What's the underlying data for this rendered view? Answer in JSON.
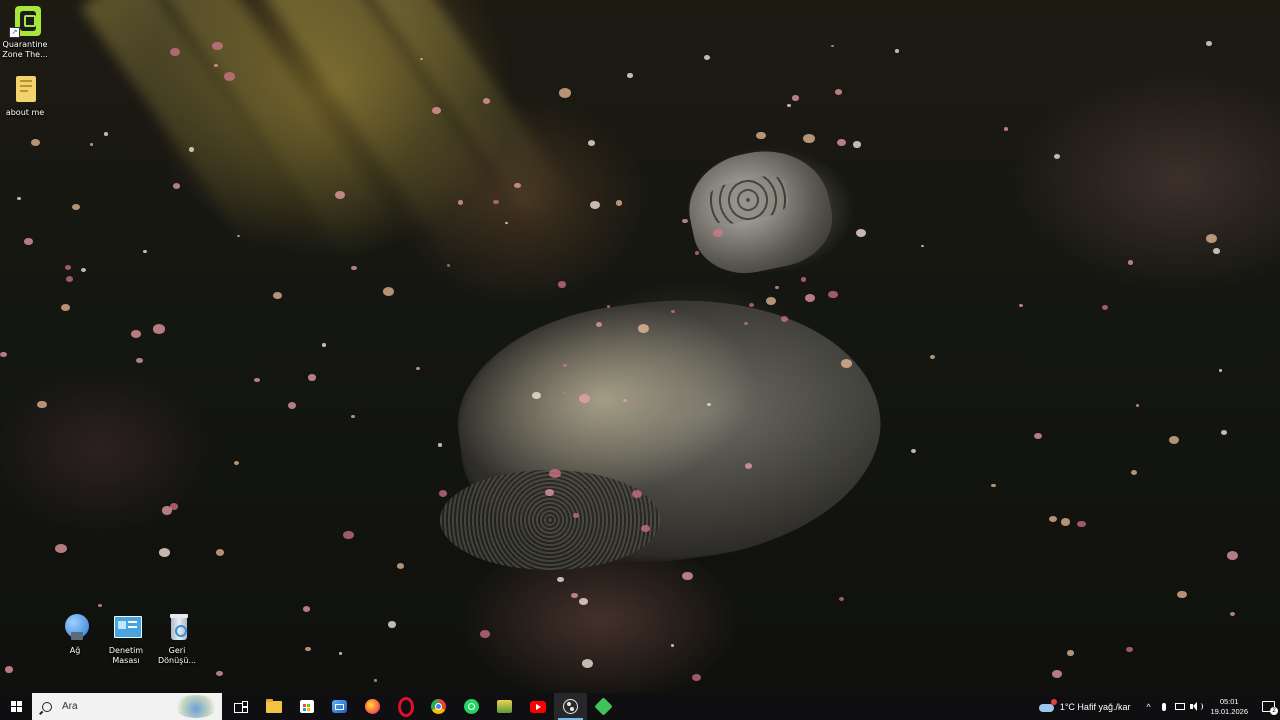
{
  "desktop_icons_top": [
    {
      "label": "Quarantine Zone The...",
      "icon": "quarantine-zone-game-icon",
      "color": "#a8e63a"
    },
    {
      "label": "about me",
      "icon": "text-file-icon",
      "color": "#f1d36b"
    }
  ],
  "desktop_icons_bottom": [
    {
      "label": "Ağ",
      "icon": "network-globe-icon",
      "color": "#3a8fe0"
    },
    {
      "label": "Denetim Masası",
      "icon": "control-panel-icon",
      "color": "#4aa3df"
    },
    {
      "label": "Geri Dönüşü...",
      "icon": "recycle-bin-icon",
      "color": "#c9d3dc"
    }
  ],
  "taskbar": {
    "search_placeholder": "Ara",
    "apps": [
      {
        "name": "task-view",
        "icon": "task-view-icon",
        "color": "#ffffff"
      },
      {
        "name": "file-explorer",
        "icon": "folder-icon",
        "color": "#f3c341"
      },
      {
        "name": "microsoft-store",
        "icon": "store-icon",
        "color": "#2f7fe0"
      },
      {
        "name": "mail",
        "icon": "mail-icon",
        "color": "#3b86d8"
      },
      {
        "name": "firefox",
        "icon": "firefox-icon",
        "color": "#ff7139"
      },
      {
        "name": "opera",
        "icon": "opera-icon",
        "color": "#e0102c"
      },
      {
        "name": "chrome",
        "icon": "chrome-icon",
        "color": "#34a853"
      },
      {
        "name": "whatsapp",
        "icon": "whatsapp-icon",
        "color": "#25d366"
      },
      {
        "name": "app-yellow",
        "icon": "app-icon",
        "color": "#d9b328"
      },
      {
        "name": "youtube",
        "icon": "youtube-icon",
        "color": "#ff0000"
      },
      {
        "name": "obs",
        "icon": "obs-icon",
        "color": "#3a3a3a"
      },
      {
        "name": "game-app",
        "icon": "game-icon",
        "color": "#3fc35a"
      }
    ]
  },
  "tray": {
    "weather_text": "1°C  Hafif yağ./kar",
    "show_hidden": "^",
    "time": "05:01",
    "date": "19.01.2026",
    "notification_count": "2"
  }
}
